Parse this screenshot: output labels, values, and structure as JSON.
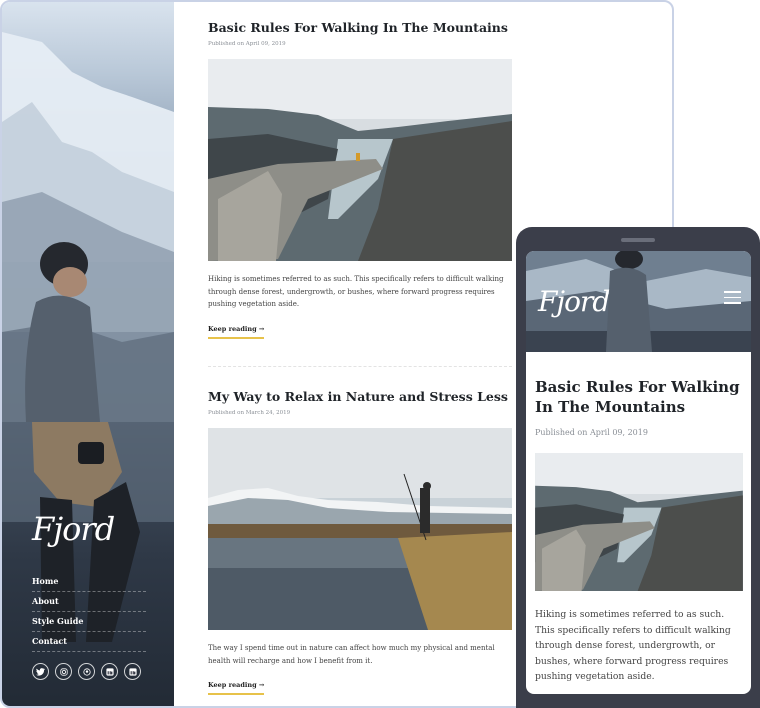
{
  "desktop": {
    "logo": "Fjord",
    "nav": [
      "Home",
      "About",
      "Style Guide",
      "Contact"
    ],
    "social_icons": [
      "twitter-icon",
      "instagram-icon",
      "github-icon",
      "linkedin-icon",
      "linkedin-icon"
    ],
    "posts": [
      {
        "title": "Basic Rules For Walking In The Mountains",
        "date": "Published on April 09, 2019",
        "excerpt": "Hiking is sometimes referred to as such. This specifically refers to difficult walking through dense forest, undergrowth, or bushes, where forward progress requires pushing vegetation aside.",
        "keep_reading": "Keep reading →"
      },
      {
        "title": "My Way to Relax in Nature and Stress Less",
        "date": "Published on March 24, 2019",
        "excerpt": "The way I spend time out in nature can affect how much my physical and mental health will recharge and how I benefit from it.",
        "keep_reading": "Keep reading →"
      }
    ]
  },
  "mobile": {
    "logo": "Fjord",
    "menu_icon": "hamburger-menu-icon",
    "post": {
      "title": "Basic Rules For Walking In The Mountains",
      "date": "Published on April 09, 2019",
      "excerpt": "Hiking is sometimes referred to as such. This specifically refers to difficult walking through dense forest, undergrowth, or bushes, where forward progress requires pushing vegetation aside."
    }
  }
}
